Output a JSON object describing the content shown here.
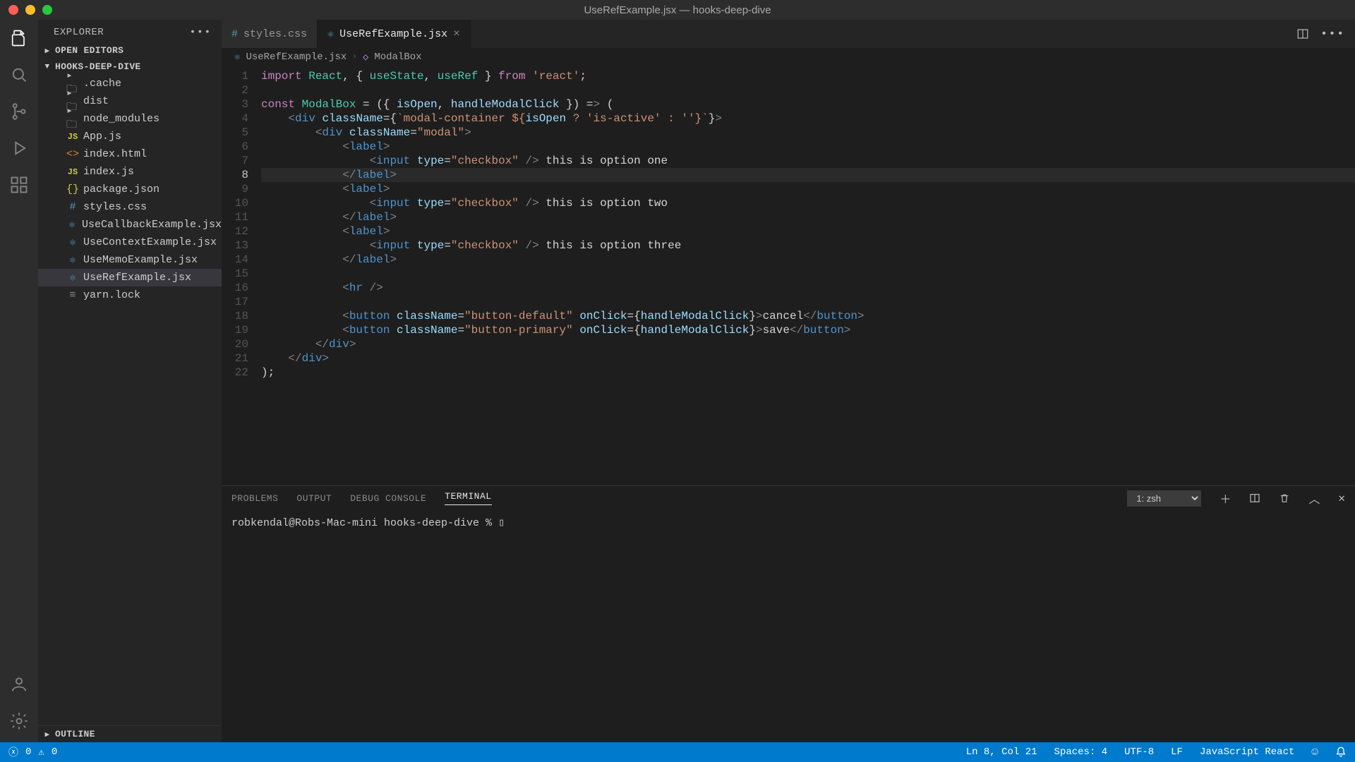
{
  "window": {
    "title": "UseRefExample.jsx — hooks-deep-dive"
  },
  "sidebar": {
    "title": "EXPLORER",
    "sections": {
      "open_editors": "OPEN EDITORS",
      "project": "HOOKS-DEEP-DIVE",
      "outline": "OUTLINE"
    },
    "tree": [
      {
        "name": ".cache",
        "kind": "folder"
      },
      {
        "name": "dist",
        "kind": "folder"
      },
      {
        "name": "node_modules",
        "kind": "folder"
      },
      {
        "name": "App.js",
        "kind": "js"
      },
      {
        "name": "index.html",
        "kind": "html"
      },
      {
        "name": "index.js",
        "kind": "js"
      },
      {
        "name": "package.json",
        "kind": "json"
      },
      {
        "name": "styles.css",
        "kind": "css"
      },
      {
        "name": "UseCallbackExample.jsx",
        "kind": "jsx"
      },
      {
        "name": "UseContextExample.jsx",
        "kind": "jsx"
      },
      {
        "name": "UseMemoExample.jsx",
        "kind": "jsx"
      },
      {
        "name": "UseRefExample.jsx",
        "kind": "jsx",
        "active": true
      },
      {
        "name": "yarn.lock",
        "kind": "lock"
      }
    ]
  },
  "tabs": [
    {
      "label": "styles.css",
      "active": false
    },
    {
      "label": "UseRefExample.jsx",
      "active": true
    }
  ],
  "breadcrumb": {
    "file": "UseRefExample.jsx",
    "symbol": "ModalBox"
  },
  "editor": {
    "current_line": 8,
    "lines": [
      "import React, { useState, useRef } from 'react';",
      "",
      "const ModalBox = ({ isOpen, handleModalClick }) => (",
      "    <div className={`modal-container ${isOpen ? 'is-active' : ''}`}>",
      "        <div className=\"modal\">",
      "            <label>",
      "                <input type=\"checkbox\" /> this is option one",
      "            </label>",
      "            <label>",
      "                <input type=\"checkbox\" /> this is option two",
      "            </label>",
      "            <label>",
      "                <input type=\"checkbox\" /> this is option three",
      "            </label>",
      "",
      "            <hr />",
      "",
      "            <button className=\"button-default\" onClick={handleModalClick}>cancel</button>",
      "            <button className=\"button-primary\" onClick={handleModalClick}>save</button>",
      "        </div>",
      "    </div>",
      ");"
    ]
  },
  "panel": {
    "tabs": [
      "PROBLEMS",
      "OUTPUT",
      "DEBUG CONSOLE",
      "TERMINAL"
    ],
    "active": "TERMINAL",
    "terminal_name": "1: zsh",
    "terminal_line": "robkendal@Robs-Mac-mini hooks-deep-dive % ▯"
  },
  "status": {
    "errors": "0",
    "warnings": "0",
    "position": "Ln 8, Col 21",
    "spaces": "Spaces: 4",
    "encoding": "UTF-8",
    "eol": "LF",
    "language": "JavaScript React"
  }
}
